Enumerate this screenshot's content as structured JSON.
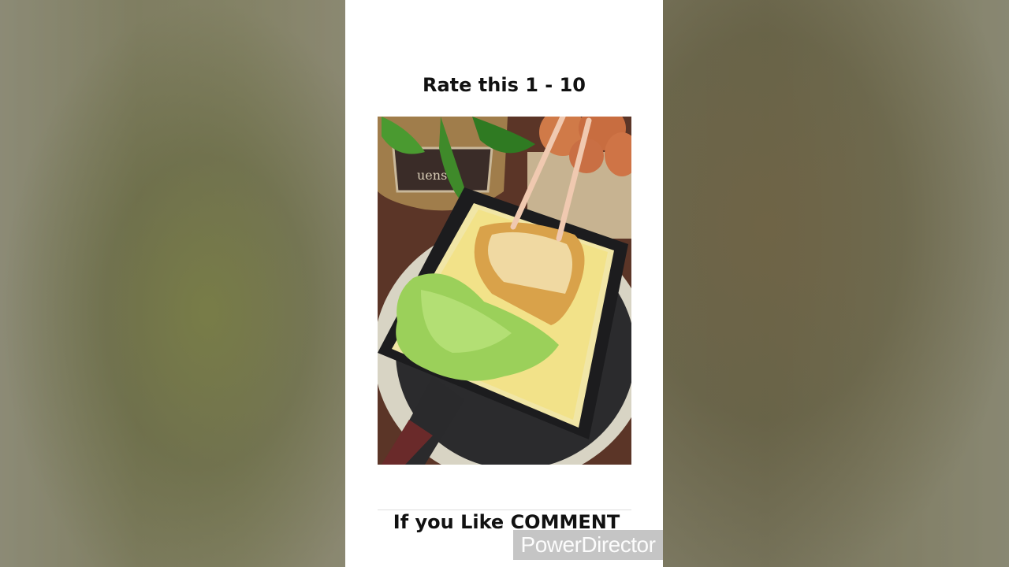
{
  "video": {
    "title_text": "Rate this 1 - 10",
    "caption_text": "If you Like COMMENT",
    "watermark_text": "PowerDirector"
  },
  "photo": {
    "subject": "food-photo-egg-sandwich-in-pan"
  }
}
